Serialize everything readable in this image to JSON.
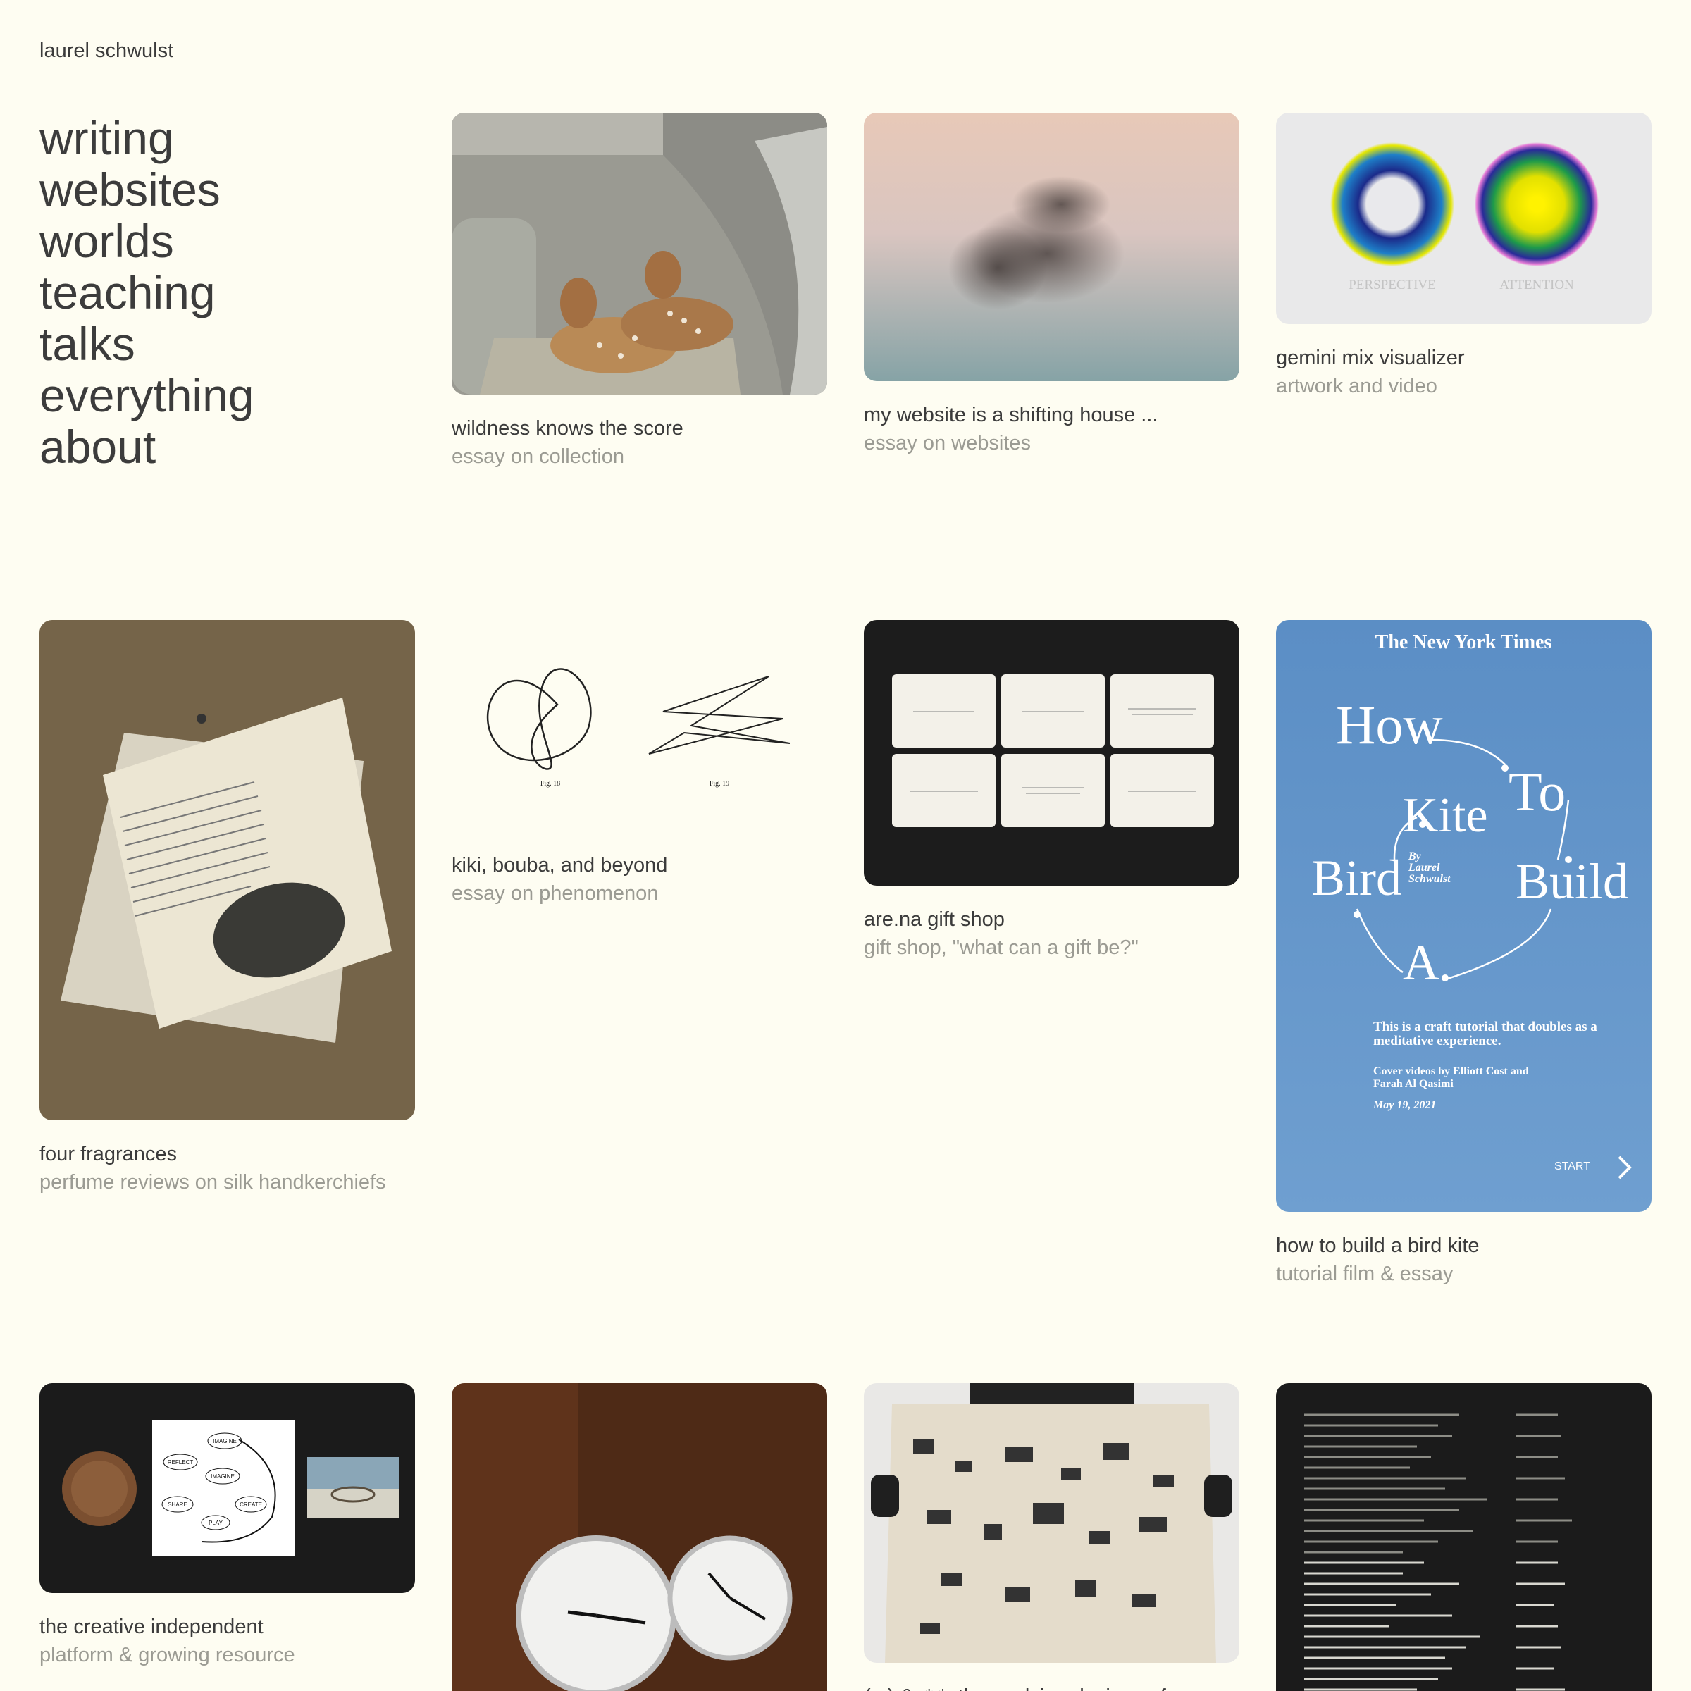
{
  "site": {
    "name": "laurel schwulst"
  },
  "nav": [
    {
      "label": "writing"
    },
    {
      "label": "websites"
    },
    {
      "label": "worlds"
    },
    {
      "label": "teaching"
    },
    {
      "label": "talks"
    },
    {
      "label": "everything"
    },
    {
      "label": "about"
    }
  ],
  "cards": [
    {
      "title": "wildness knows the score",
      "subtitle": "essay on collection",
      "icon": "fawns-in-car-image"
    },
    {
      "title": "my website is a shifting house ...",
      "subtitle": "essay on websites",
      "icon": "starling-murmuration-image"
    },
    {
      "title": "gemini mix visualizer",
      "subtitle": "artwork and video",
      "icon": "gradient-circles-image",
      "image_text": {
        "left": "PERSPECTIVE",
        "right": "ATTENTION"
      }
    },
    {
      "title": "four fragrances",
      "subtitle": "perfume reviews on silk handkerchiefs",
      "icon": "silk-handkerchiefs-image"
    },
    {
      "title": "kiki, bouba, and beyond",
      "subtitle": "essay on phenomenon",
      "icon": "kiki-bouba-figures-image",
      "image_text": {
        "left": "Fig. 18",
        "right": "Fig. 19"
      }
    },
    {
      "title": "are.na gift shop",
      "subtitle": "gift shop, \"what can a gift be?\"",
      "icon": "gift-cards-image"
    },
    {
      "title": "how to build a bird kite",
      "subtitle": "tutorial film & essay",
      "icon": "bird-kite-poster-image",
      "poster": {
        "masthead": "The New York Times",
        "words": {
          "how": "How",
          "to": "To",
          "kite": "Kite",
          "bird": "Bird",
          "build": "Build",
          "a": "A"
        },
        "byline": [
          "By",
          "Laurel",
          "Schwulst"
        ],
        "desc": [
          "This is a craft tutorial that doubles as a",
          "meditative experience."
        ],
        "credits": [
          "Cover videos by Elliott Cost and",
          "Farah Al Qasimi"
        ],
        "date": "May 19, 2021",
        "start": "START"
      }
    },
    {
      "title": "the creative independent",
      "subtitle": "platform & growing resource",
      "icon": "creative-cycle-image",
      "cycle": [
        "IMAGINE",
        "REFLECT",
        "IMAGINE",
        "SHARE",
        "CREATE",
        "PLAY"
      ]
    },
    {
      "title": "",
      "subtitle": "",
      "icon": "wall-clocks-image"
    },
    {
      "title": "(...) & .*.*: the evolving designs of",
      "subtitle": "",
      "icon": "broadsheet-poster-image"
    },
    {
      "title": "",
      "subtitle": "",
      "icon": "seasonal-calendar-image"
    }
  ]
}
